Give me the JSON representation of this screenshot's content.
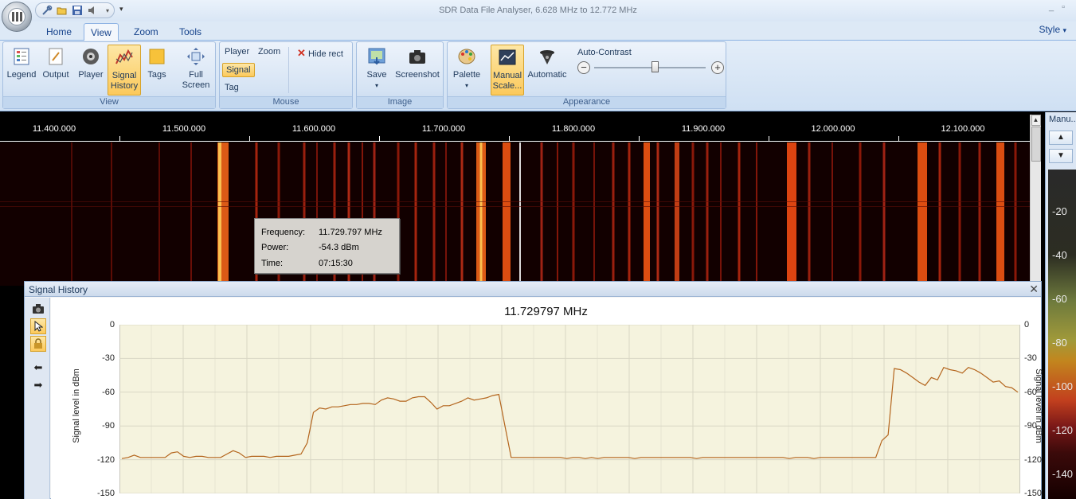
{
  "window": {
    "title": "SDR Data File Analyser, 6.628 MHz to 12.772 MHz",
    "min_label": "_",
    "max_label": "▫"
  },
  "tabs": [
    {
      "label": "Home"
    },
    {
      "label": "View"
    },
    {
      "label": "Zoom"
    },
    {
      "label": "Tools"
    }
  ],
  "style_menu": "Style",
  "ribbon": {
    "view": {
      "label": "View",
      "buttons": {
        "legend": "Legend",
        "output": "Output",
        "player": "Player",
        "signal_history_1": "Signal",
        "signal_history_2": "History",
        "tags": "Tags",
        "full_screen_1": "Full",
        "full_screen_2": "Screen"
      }
    },
    "mouse": {
      "label": "Mouse",
      "player": "Player",
      "zoom": "Zoom",
      "signal": "Signal",
      "tag": "Tag",
      "hide_rect": "Hide rect"
    },
    "image": {
      "label": "Image",
      "save": "Save",
      "screenshot": "Screenshot"
    },
    "appearance": {
      "label": "Appearance",
      "palette": "Palette",
      "manual_scale_1": "Manual",
      "manual_scale_2": "Scale...",
      "automatic": "Automatic",
      "auto_contrast": "Auto-Contrast",
      "contrast_level": 0.55
    }
  },
  "freq_axis": {
    "labels": [
      "11.400.000",
      "11.500.000",
      "11.600.000",
      "11.700.000",
      "11.800.000",
      "11.900.000",
      "12.000.000",
      "12.100.000"
    ]
  },
  "tooltip": {
    "frequency_label": "Frequency:",
    "frequency_value": "11.729.797 MHz",
    "power_label": "Power:",
    "power_value": "-54.3 dBm",
    "time_label": "Time:",
    "time_value": "07:15:30"
  },
  "palette_panel": {
    "title": "Manu...",
    "labels": [
      "-20",
      "-40",
      "-60",
      "-80",
      "-100",
      "-120",
      "-140"
    ]
  },
  "signal_history": {
    "panel_title": "Signal History",
    "close": "✕",
    "chart_data": {
      "type": "line",
      "title": "11.729797 MHz",
      "ylabel": "Signal level in dBm",
      "ylim": [
        -150,
        0
      ],
      "yticks": [
        0,
        -30,
        -60,
        -90,
        -120,
        -150
      ],
      "series": [
        {
          "values": [
            -119,
            -118,
            -116,
            -118,
            -118,
            -118,
            -118,
            -118,
            -114,
            -113,
            -117,
            -118,
            -117,
            -117,
            -118,
            -118,
            -118,
            -115,
            -112,
            -114,
            -118,
            -117,
            -117,
            -117,
            -118,
            -117,
            -117,
            -117,
            -116,
            -115,
            -105,
            -78,
            -74,
            -75,
            -73,
            -73,
            -72,
            -71,
            -71,
            -70,
            -70,
            -71,
            -67,
            -65,
            -66,
            -68,
            -68,
            -65,
            -64,
            -64,
            -69,
            -75,
            -72,
            -72,
            -70,
            -68,
            -65,
            -67,
            -66,
            -65,
            -63,
            -62,
            -90,
            -118,
            -118,
            -118,
            -118,
            -118,
            -118,
            -118,
            -118,
            -118,
            -119,
            -118,
            -118,
            -119,
            -118,
            -119,
            -118,
            -118,
            -118,
            -118,
            -118,
            -119,
            -118,
            -118,
            -118,
            -118,
            -118,
            -118,
            -118,
            -118,
            -118,
            -119,
            -118,
            -118,
            -118,
            -118,
            -118,
            -118,
            -118,
            -118,
            -118,
            -118,
            -118,
            -118,
            -118,
            -118,
            -119,
            -118,
            -118,
            -118,
            -119,
            -118,
            -118,
            -118,
            -118,
            -118,
            -118,
            -118,
            -118,
            -118,
            -118,
            -103,
            -98,
            -39,
            -40,
            -43,
            -47,
            -51,
            -54,
            -47,
            -49,
            -38,
            -40,
            -41,
            -43,
            -38,
            -40,
            -43,
            -47,
            -51,
            -50,
            -55,
            -56,
            -60
          ]
        }
      ]
    }
  }
}
